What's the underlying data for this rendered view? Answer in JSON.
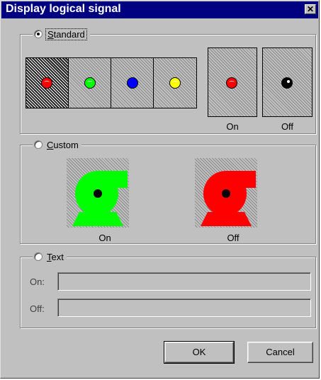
{
  "window": {
    "title": "Display logical signal",
    "close_glyph": "✕"
  },
  "standard": {
    "label": "Standard",
    "selected": true,
    "colors": [
      "#ff0000",
      "#00ff00",
      "#0000ff",
      "#ffff00"
    ],
    "on_color": "#ff0000",
    "off_color": "#000000",
    "on_label": "On",
    "off_label": "Off"
  },
  "custom": {
    "label": "Custom",
    "selected": false,
    "on_color": "#00ff00",
    "off_color": "#ff0000",
    "on_label": "On",
    "off_label": "Off"
  },
  "text": {
    "label": "Text",
    "selected": false,
    "on_label": "On:",
    "off_label": "Off:",
    "on_value": "",
    "off_value": ""
  },
  "buttons": {
    "ok": "OK",
    "cancel": "Cancel"
  }
}
